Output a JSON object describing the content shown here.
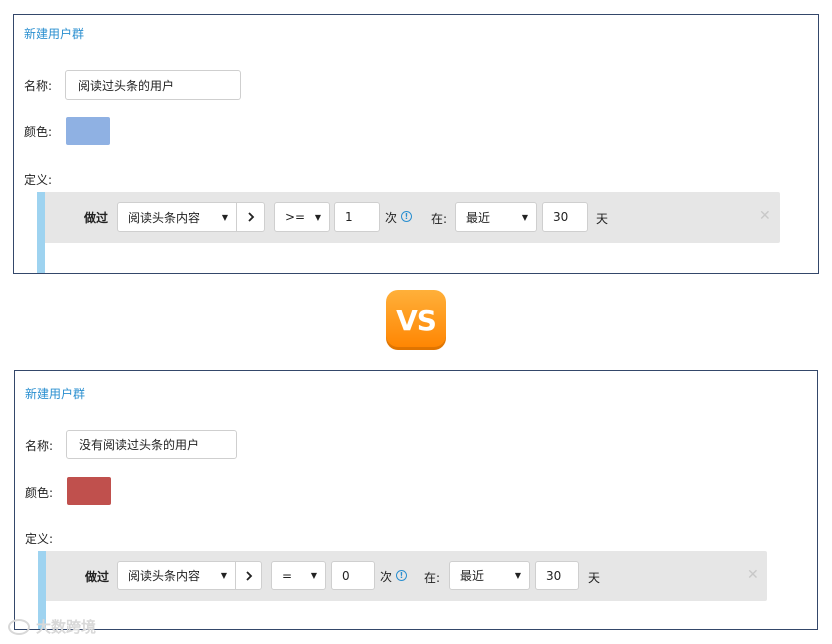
{
  "vs_label": "VS",
  "watermark": "大数跨境",
  "top": {
    "title": "新建用户群",
    "name_label": "名称:",
    "name_value": "阅读过头条的用户",
    "color_label": "颜色:",
    "color": "#8fb1e3",
    "def_label": "定义:",
    "rule": {
      "action": "做过",
      "event": "阅读头条内容",
      "operator": ">=",
      "count": "1",
      "count_unit": "次",
      "time_label": "在:",
      "period": "最近",
      "days": "30",
      "days_unit": "天"
    }
  },
  "bottom": {
    "title": "新建用户群",
    "name_label": "名称:",
    "name_value": "没有阅读过头条的用户",
    "color_label": "颜色:",
    "color": "#c0504d",
    "def_label": "定义:",
    "rule": {
      "action": "做过",
      "event": "阅读头条内容",
      "operator": "=",
      "count": "0",
      "count_unit": "次",
      "time_label": "在:",
      "period": "最近",
      "days": "30",
      "days_unit": "天"
    }
  },
  "colors": {
    "accent": "#2a8fd0",
    "border": "#34476a",
    "rule_bg": "#e6e6e6",
    "rule_bar": "#9ed3f0",
    "vs_orange": "#ff8c00"
  }
}
